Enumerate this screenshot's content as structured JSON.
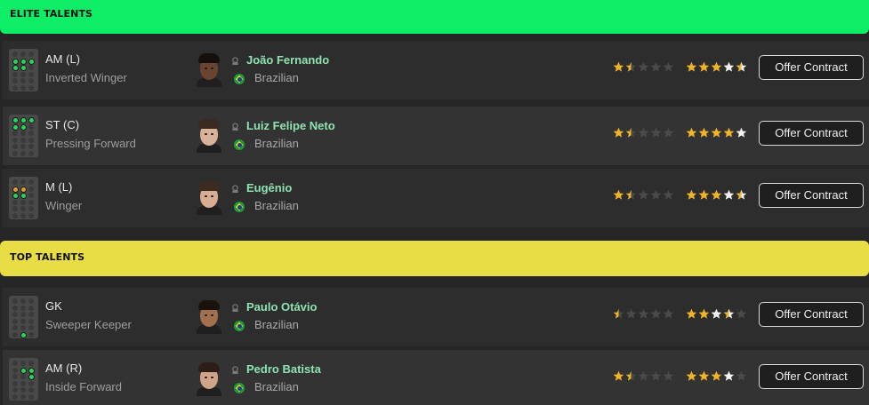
{
  "sections": {
    "elite": "ELITE TALENTS",
    "top": "TOP TALENTS"
  },
  "colors": {
    "elite_header": "#0ded66",
    "top_header": "#e9dd45",
    "star_gold": "#f0b429",
    "star_dim": "#4a4a4a",
    "star_white": "#f5f5f5",
    "name_green": "#8fe3b0"
  },
  "players": [
    {
      "position": "AM (L)",
      "role": "Inverted Winger",
      "name": "João Fernando",
      "nationality": "Brazilian",
      "current_ability_stars": 1.5,
      "potential_ability_stars": 4.5,
      "offer_label": "Offer Contract",
      "icons": [
        "player-icon",
        "brazil-flag-icon"
      ]
    },
    {
      "position": "ST (C)",
      "role": "Pressing Forward",
      "name": "Luiz Felipe Neto",
      "nationality": "Brazilian",
      "current_ability_stars": 1.5,
      "potential_ability_stars": 5,
      "offer_label": "Offer Contract",
      "icons": [
        "player-icon",
        "brazil-flag-icon"
      ]
    },
    {
      "position": "M (L)",
      "role": "Winger",
      "name": "Eugênio",
      "nationality": "Brazilian",
      "current_ability_stars": 1.5,
      "potential_ability_stars": 4.5,
      "offer_label": "Offer Contract",
      "icons": [
        "player-icon",
        "brazil-flag-icon"
      ]
    },
    {
      "position": "GK",
      "role": "Sweeper Keeper",
      "name": "Paulo Otávio",
      "nationality": "Brazilian",
      "current_ability_stars": 0.5,
      "potential_ability_stars": 3.5,
      "offer_label": "Offer Contract",
      "icons": [
        "player-icon",
        "brazil-flag-icon"
      ]
    },
    {
      "position": "AM (R)",
      "role": "Inside Forward",
      "name": "Pedro Batista",
      "nationality": "Brazilian",
      "current_ability_stars": 1.5,
      "potential_ability_stars": 4,
      "offer_label": "Offer Contract",
      "icons": [
        "player-icon",
        "brazil-flag-icon"
      ]
    }
  ]
}
